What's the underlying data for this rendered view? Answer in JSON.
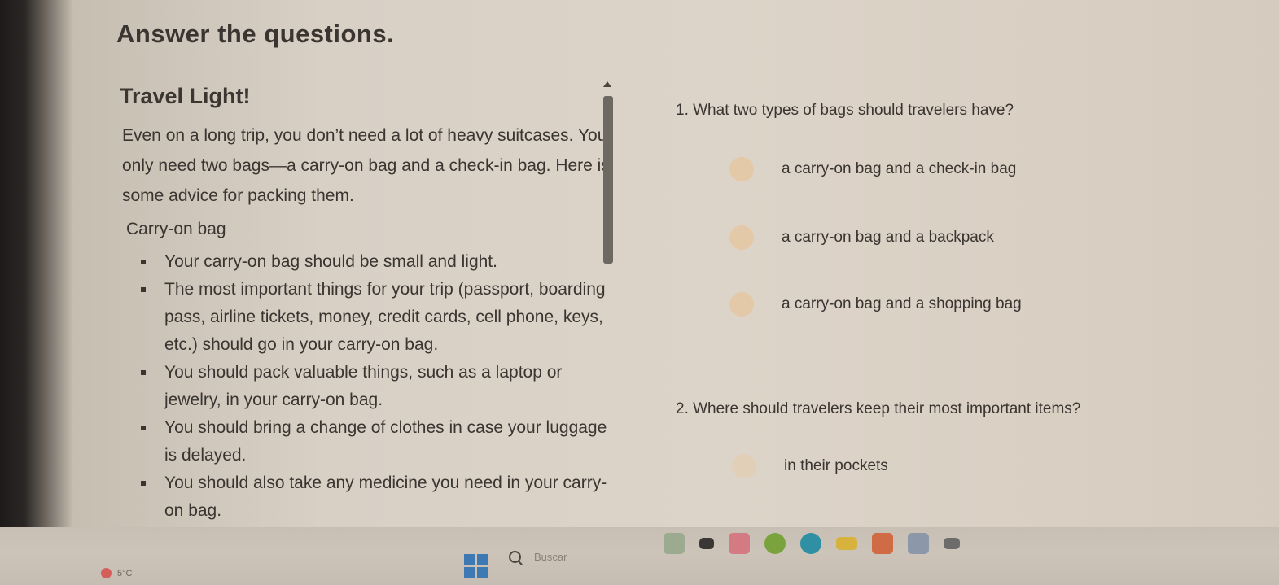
{
  "page": {
    "title": "Answer the questions."
  },
  "article": {
    "title": "Travel Light!",
    "intro": "Even on a long trip, you don’t need a lot of heavy suitcases. You only need two bags—a carry-on bag and a check-in bag. Here is some advice for packing them.",
    "section_label": "Carry-on bag",
    "bullets": [
      "Your carry-on bag should be small and light.",
      "The most important things for your trip (passport, boarding pass, airline tickets, money, credit cards, cell phone, keys, etc.) should go in your carry-on bag.",
      "You should pack valuable things, such as a laptop or jewelry, in your carry-on bag.",
      "You should bring a change of clothes in case your luggage is delayed.",
      "You should also take any medicine you need in your carry-on bag."
    ]
  },
  "questions": [
    {
      "text": "1.  What two types of bags should travelers have?",
      "options": [
        "a carry-on bag and a check-in bag",
        "a carry-on bag and a backpack",
        "a carry-on bag and a shopping bag"
      ]
    },
    {
      "text": "2.  Where should travelers keep their most important items?",
      "options": [
        "in their pockets"
      ]
    }
  ],
  "taskbar": {
    "weather": "5°C",
    "search_placeholder": "Buscar",
    "icons": [
      "browser-icon",
      "file-explorer-icon",
      "paint-icon",
      "chrome-icon",
      "edge-icon",
      "folder-icon",
      "office-icon",
      "app-icon",
      "app-icon-2"
    ]
  },
  "colors": {
    "radio": "#e4c9a8",
    "text": "#3a3531",
    "start_blue": "#3d7ab3"
  }
}
